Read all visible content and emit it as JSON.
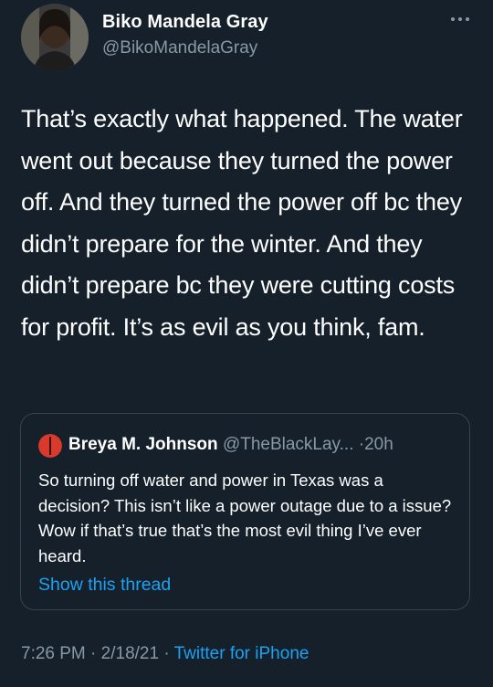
{
  "author": {
    "name": "Biko Mandela Gray",
    "handle": "@BikoMandelaGray"
  },
  "tweet": {
    "text": "That’s exactly what happened. The water went out because they turned the power off. And they turned the power off bc they didn’t prepare for the winter. And they didn’t prepare bc they were cutting costs for profit. It’s as evil as you think, fam."
  },
  "quoted_tweet": {
    "name": "Breya M. Johnson",
    "handle": "@TheBlackLay...",
    "separator": "·",
    "time": "20h",
    "text": "So turning off water and power in Texas was a decision? This isn’t like a  power outage due to a issue? Wow if that’s true that’s the most evil thing I’ve ever heard.",
    "show_thread_label": "Show this thread"
  },
  "meta": {
    "time": "7:26 PM",
    "date": "2/18/21",
    "separator": "·",
    "source": "Twitter for iPhone"
  },
  "colors": {
    "background": "#15202b",
    "text_primary": "#ffffff",
    "text_secondary": "#8899a6",
    "link": "#1da1f2",
    "border": "#38444d",
    "quote_avatar": "#d93a2b"
  },
  "icons": {
    "more": "more-horizontal-icon"
  }
}
